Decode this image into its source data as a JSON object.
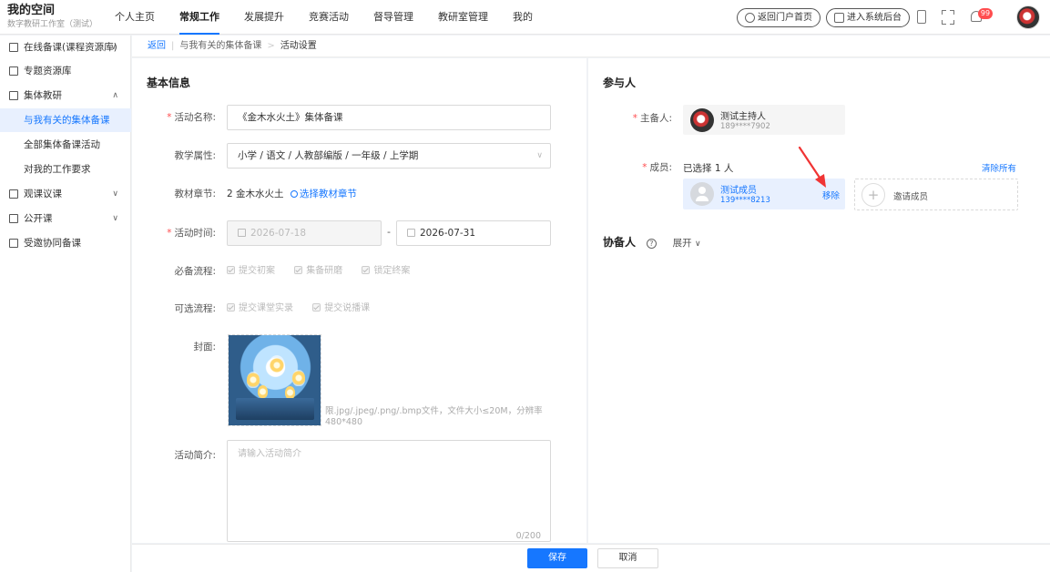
{
  "header": {
    "title": "我的空间",
    "subtitle": "数字教研工作室（测试）",
    "nav": [
      "个人主页",
      "常规工作",
      "发展提升",
      "竞赛活动",
      "督导管理",
      "教研室管理",
      "我的"
    ],
    "portal_btn": "返回门户首页",
    "backend_btn": "进入系统后台",
    "notify_count": "99"
  },
  "sidebar": {
    "items": [
      {
        "label": "在线备课(课程资源库)"
      },
      {
        "label": "专题资源库"
      },
      {
        "label": "集体教研"
      },
      {
        "label": "与我有关的集体备课"
      },
      {
        "label": "全部集体备课活动"
      },
      {
        "label": "对我的工作要求"
      },
      {
        "label": "观课议课"
      },
      {
        "label": "公开课"
      },
      {
        "label": "受邀协同备课"
      }
    ]
  },
  "breadcrumb": {
    "back": "返回",
    "parent": "与我有关的集体备课",
    "current": "活动设置"
  },
  "basic": {
    "title": "基本信息",
    "name_label": "活动名称:",
    "name_value": "《金木水火土》集体备课",
    "attr_label": "教学属性:",
    "attr_value": "小学 / 语文 / 人教部编版 / 一年级 / 上学期",
    "chapter_label": "教材章节:",
    "chapter_value": "2 金木水火土",
    "chapter_link": "选择教材章节",
    "time_label": "活动时间:",
    "start_date": "2026-07-18",
    "date_sep": "-",
    "end_date": "2026-07-31",
    "required_label": "必备流程:",
    "required_steps": [
      "提交初案",
      "集备研磨",
      "锁定终案"
    ],
    "optional_label": "可选流程:",
    "optional_steps": [
      "提交课堂实录",
      "提交说播课"
    ],
    "cover_label": "封面:",
    "cover_tip": "限.jpg/.jpeg/.png/.bmp文件，文件大小≤20M，分辨率480*480",
    "intro_label": "活动简介:",
    "intro_placeholder": "请输入活动简介",
    "intro_counter": "0/200"
  },
  "participants": {
    "title": "参与人",
    "host_label": "主备人:",
    "host_name": "测试主持人",
    "host_phone": "189****7902",
    "member_label": "成员:",
    "selected_text": "已选择 1 人",
    "clear_all": "清除所有",
    "member_name": "测试成员",
    "member_phone": "139****8213",
    "remove": "移除",
    "invite": "邀请成员",
    "co_title": "协备人",
    "expand": "展开"
  },
  "footer": {
    "save": "保存",
    "cancel": "取消"
  }
}
